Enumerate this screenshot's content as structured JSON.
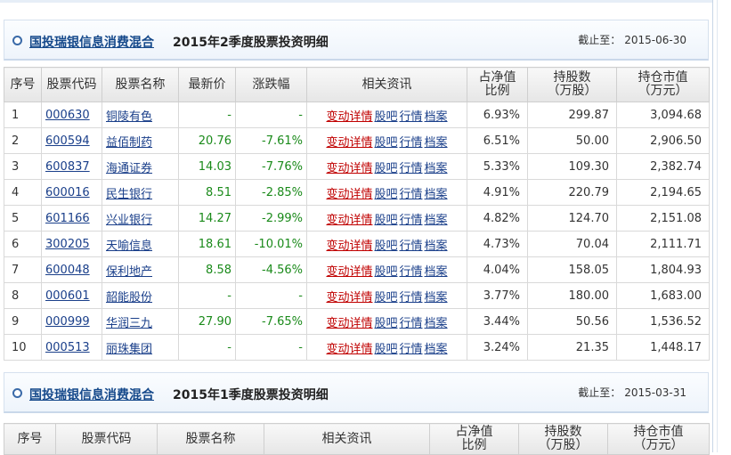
{
  "section1": {
    "fund_name": "国投瑞银信息消费混合",
    "title": "2015年2季度股票投资明细",
    "as_of_label": "截止至：",
    "as_of_date": "2015-06-30",
    "headers": {
      "no": "序号",
      "code": "股票代码",
      "name": "股票名称",
      "price": "最新价",
      "change": "涨跌幅",
      "news": "相关资讯",
      "pct_line1": "占净值",
      "pct_line2": "比例",
      "shares_line1": "持股数",
      "shares_line2": "（万股）",
      "value_line1": "持仓市值",
      "value_line2": "（万元）"
    },
    "news_links": {
      "detail": "变动详情",
      "forum": "股吧",
      "quote": "行情",
      "archive": "档案"
    },
    "rows": [
      {
        "no": "1",
        "code": "000630",
        "name": "铜陵有色",
        "price": "-",
        "change": "-",
        "pct": "6.93%",
        "shares": "299.87",
        "value": "3,094.68"
      },
      {
        "no": "2",
        "code": "600594",
        "name": "益佰制药",
        "price": "20.76",
        "change": "-7.61%",
        "pct": "6.51%",
        "shares": "50.00",
        "value": "2,906.50"
      },
      {
        "no": "3",
        "code": "600837",
        "name": "海通证券",
        "price": "14.03",
        "change": "-7.76%",
        "pct": "5.33%",
        "shares": "109.30",
        "value": "2,382.74"
      },
      {
        "no": "4",
        "code": "600016",
        "name": "民生银行",
        "price": "8.51",
        "change": "-2.85%",
        "pct": "4.91%",
        "shares": "220.79",
        "value": "2,194.65"
      },
      {
        "no": "5",
        "code": "601166",
        "name": "兴业银行",
        "price": "14.27",
        "change": "-2.99%",
        "pct": "4.82%",
        "shares": "124.70",
        "value": "2,151.08"
      },
      {
        "no": "6",
        "code": "300205",
        "name": "天喻信息",
        "price": "18.61",
        "change": "-10.01%",
        "pct": "4.73%",
        "shares": "70.04",
        "value": "2,111.71"
      },
      {
        "no": "7",
        "code": "600048",
        "name": "保利地产",
        "price": "8.58",
        "change": "-4.56%",
        "pct": "4.04%",
        "shares": "158.05",
        "value": "1,804.93"
      },
      {
        "no": "8",
        "code": "000601",
        "name": "韶能股份",
        "price": "-",
        "change": "-",
        "pct": "3.77%",
        "shares": "180.00",
        "value": "1,683.00"
      },
      {
        "no": "9",
        "code": "000999",
        "name": "华润三九",
        "price": "27.90",
        "change": "-7.65%",
        "pct": "3.44%",
        "shares": "50.56",
        "value": "1,536.52"
      },
      {
        "no": "10",
        "code": "000513",
        "name": "丽珠集团",
        "price": "-",
        "change": "-",
        "pct": "3.24%",
        "shares": "21.35",
        "value": "1,448.17"
      }
    ]
  },
  "section2": {
    "fund_name": "国投瑞银信息消费混合",
    "title": "2015年1季度股票投资明细",
    "as_of_label": "截止至：",
    "as_of_date": "2015-03-31",
    "headers": {
      "no": "序号",
      "code": "股票代码",
      "name": "股票名称",
      "news": "相关资讯",
      "pct_line1": "占净值",
      "pct_line2": "比例",
      "shares_line1": "持股数",
      "shares_line2": "（万股）",
      "value_line1": "持仓市值",
      "value_line2": "（万元）"
    }
  }
}
